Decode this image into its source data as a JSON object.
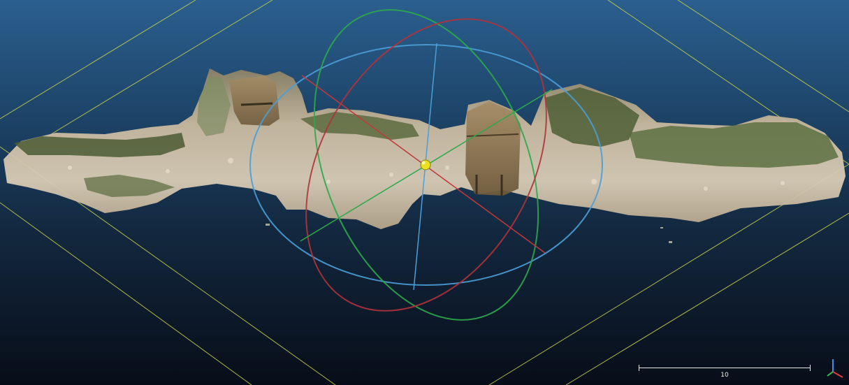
{
  "viewer": {
    "background_top": "#2b5f8f",
    "background_bottom": "#070d18",
    "grid_color": "#c9d44a"
  },
  "gizmo": {
    "x_axis_color": "#c0393b",
    "y_axis_color": "#2ea84b",
    "z_axis_color": "#4a9fd8",
    "pivot_color": "#e8e020"
  },
  "scale_bar": {
    "label": "10"
  },
  "axes_indicator": {
    "icon": "xyz-axes-icon",
    "x_color": "#e23b3b",
    "y_color": "#34c24f",
    "z_color": "#3f8fe8"
  }
}
